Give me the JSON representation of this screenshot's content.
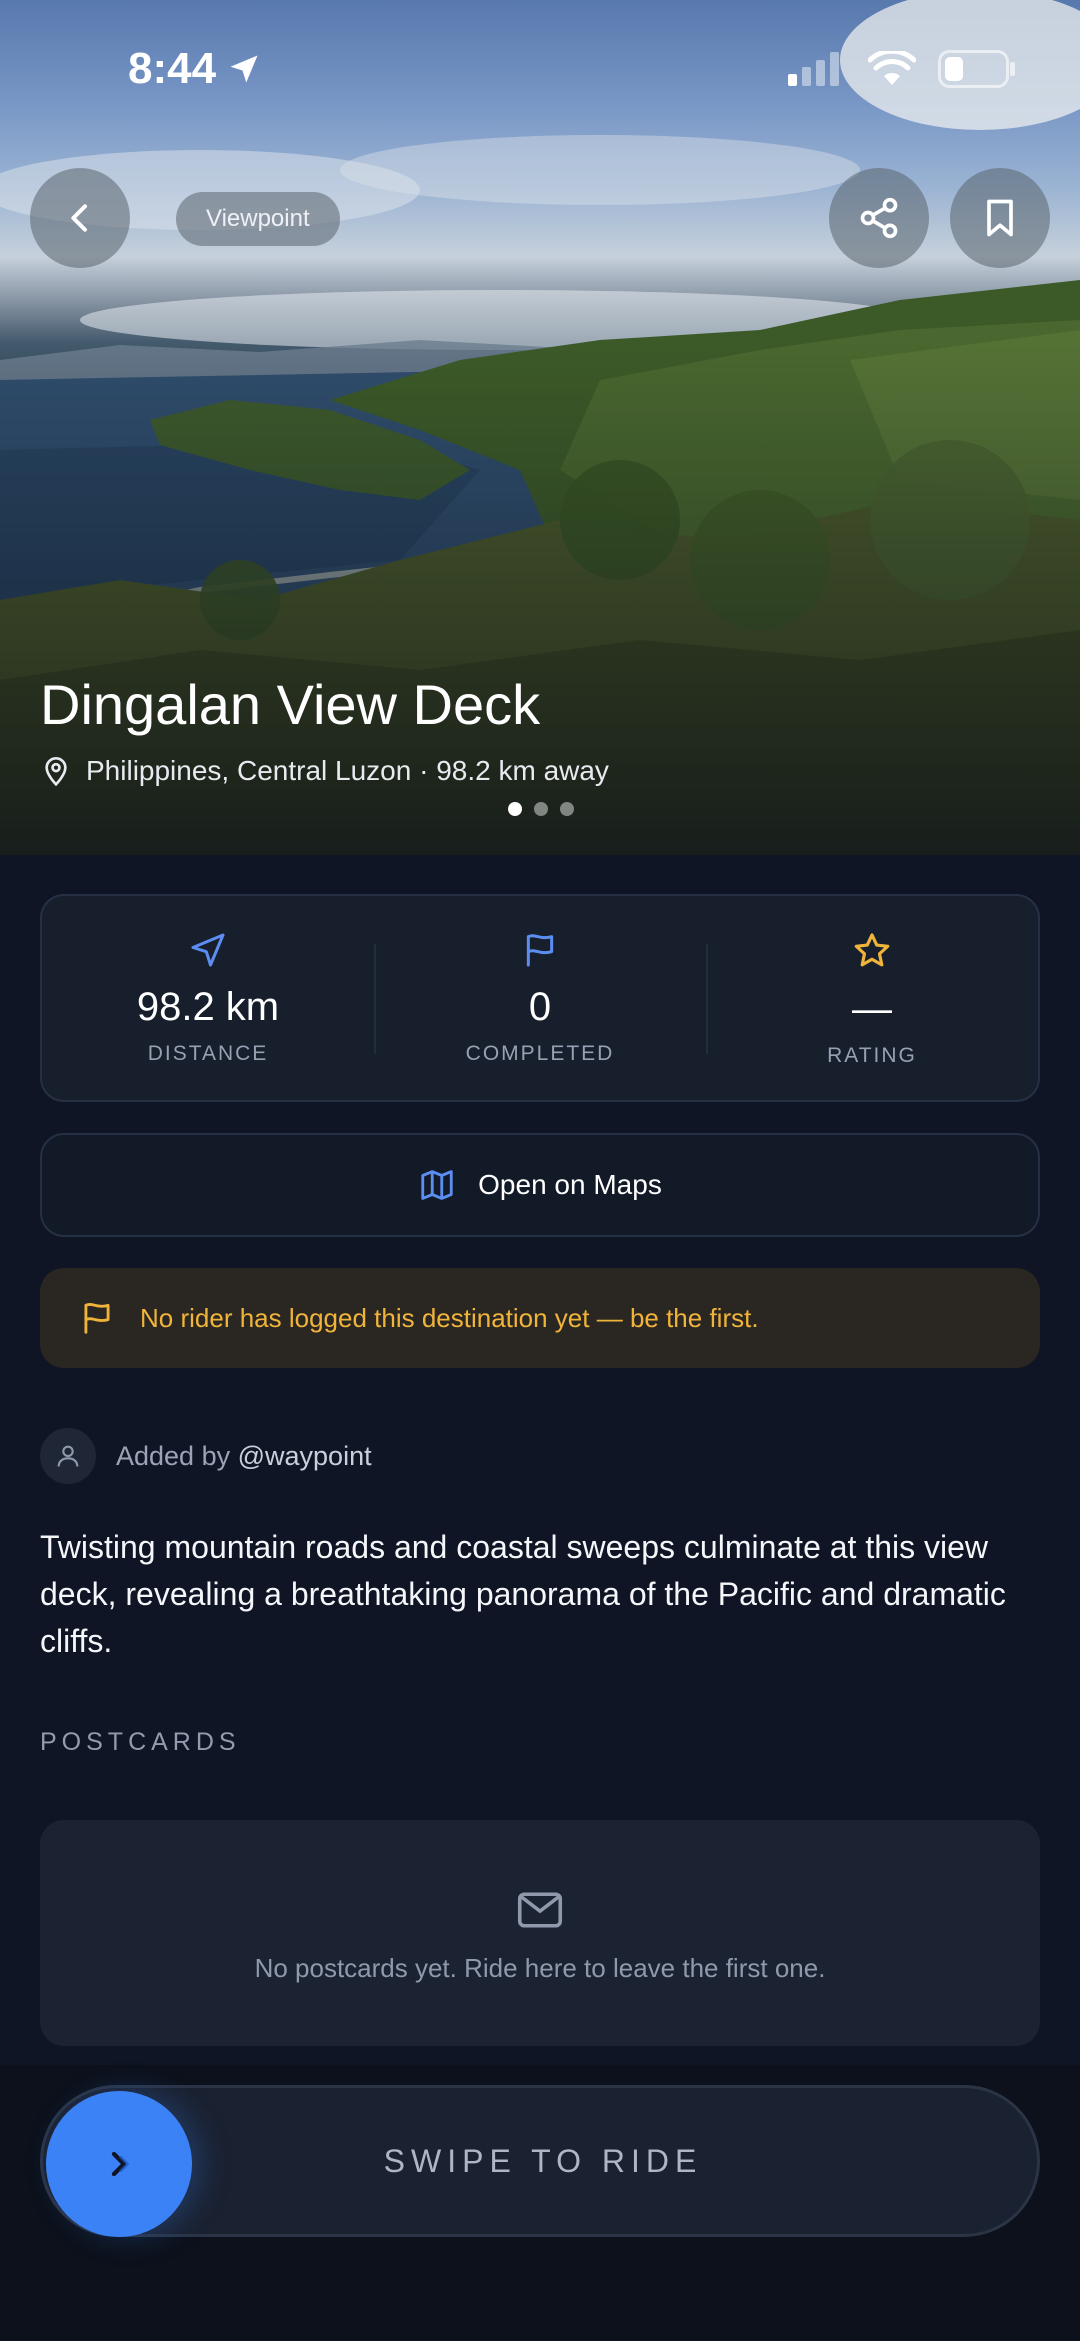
{
  "status_bar": {
    "time": "8:44"
  },
  "hero": {
    "category_pill": "Viewpoint",
    "title": "Dingalan View Deck",
    "location": "Philippines, Central Luzon · 98.2 km away",
    "carousel_pages": 3,
    "carousel_active_index": 0
  },
  "stats": [
    {
      "icon": "navigation-arrow-icon",
      "value": "98.2 km",
      "label": "DISTANCE",
      "accent": "#5b8ef0"
    },
    {
      "icon": "flag-icon",
      "value": "0",
      "label": "COMPLETED",
      "accent": "#5b8ef0"
    },
    {
      "icon": "star-icon",
      "value": "—",
      "label": "RATING",
      "accent": "#f1b43a"
    }
  ],
  "maps_button": {
    "icon": "map-icon",
    "label": "Open on Maps"
  },
  "notice": {
    "icon": "flag-icon",
    "text": "No rider has logged this destination yet — be the first."
  },
  "added_by": {
    "prefix": "Added by",
    "handle": "@waypoint"
  },
  "description": "Twisting mountain roads and coastal sweeps culminate at this view deck, revealing a breathtaking panorama of the Pacific and dramatic cliffs.",
  "postcards": {
    "section_label": "POSTCARDS",
    "empty_icon": "mail-icon",
    "empty_text": "No postcards yet. Ride here to leave the first one."
  },
  "swipe": {
    "label": "SWIPE TO RIDE"
  },
  "colors": {
    "accent_blue": "#3b82f6",
    "warning_amber": "#f1b43a",
    "background": "#0f1524"
  }
}
